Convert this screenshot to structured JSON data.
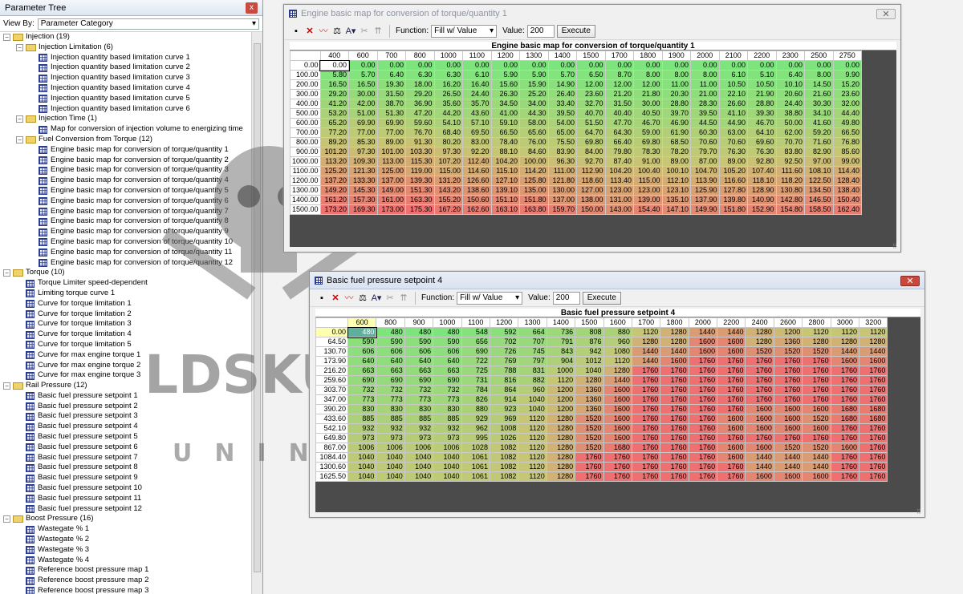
{
  "tree": {
    "title": "Parameter Tree",
    "close": "x",
    "view_by_label": "View By:",
    "view_by_value": "Parameter Category",
    "nodes": [
      {
        "t": "Injection (19)",
        "l": 0,
        "k": "f"
      },
      {
        "t": "Injection Limitation (6)",
        "l": 1,
        "k": "f"
      },
      {
        "t": "Injection quantity based limitation curve 1",
        "l": 2,
        "k": "m"
      },
      {
        "t": "Injection quantity based limitation curve 2",
        "l": 2,
        "k": "m"
      },
      {
        "t": "Injection quantity based limitation curve 3",
        "l": 2,
        "k": "m"
      },
      {
        "t": "Injection quantity based limitation curve 4",
        "l": 2,
        "k": "m"
      },
      {
        "t": "Injection quantity based limitation curve 5",
        "l": 2,
        "k": "m"
      },
      {
        "t": "Injection quantity based limitation curve 6",
        "l": 2,
        "k": "m"
      },
      {
        "t": "Injection Time (1)",
        "l": 1,
        "k": "f"
      },
      {
        "t": "Map for conversion of injection volume to energizing time",
        "l": 2,
        "k": "m"
      },
      {
        "t": "Fuel Conversion from Torque (12)",
        "l": 1,
        "k": "f"
      },
      {
        "t": "Engine basic map for conversion of torque/quantity 1",
        "l": 2,
        "k": "m"
      },
      {
        "t": "Engine basic map for conversion of torque/quantity 2",
        "l": 2,
        "k": "m"
      },
      {
        "t": "Engine basic map for conversion of torque/quantity 3",
        "l": 2,
        "k": "m"
      },
      {
        "t": "Engine basic map for conversion of torque/quantity 4",
        "l": 2,
        "k": "m"
      },
      {
        "t": "Engine basic map for conversion of torque/quantity 5",
        "l": 2,
        "k": "m"
      },
      {
        "t": "Engine basic map for conversion of torque/quantity 6",
        "l": 2,
        "k": "m"
      },
      {
        "t": "Engine basic map for conversion of torque/quantity 7",
        "l": 2,
        "k": "m"
      },
      {
        "t": "Engine basic map for conversion of torque/quantity 8",
        "l": 2,
        "k": "m"
      },
      {
        "t": "Engine basic map for conversion of torque/quantity 9",
        "l": 2,
        "k": "m"
      },
      {
        "t": "Engine basic map for conversion of torque/quantity 10",
        "l": 2,
        "k": "m"
      },
      {
        "t": "Engine basic map for conversion of torque/quantity 11",
        "l": 2,
        "k": "m"
      },
      {
        "t": "Engine basic map for conversion of torque/quantity 12",
        "l": 2,
        "k": "m"
      },
      {
        "t": "Torque (10)",
        "l": 0,
        "k": "f"
      },
      {
        "t": "Torque Limiter speed-dependent",
        "l": 1,
        "k": "m"
      },
      {
        "t": "Limiting torque curve 1",
        "l": 1,
        "k": "m"
      },
      {
        "t": "Curve for torque limitation 1",
        "l": 1,
        "k": "m"
      },
      {
        "t": "Curve for torque limitation 2",
        "l": 1,
        "k": "m"
      },
      {
        "t": "Curve for torque limitation 3",
        "l": 1,
        "k": "m"
      },
      {
        "t": "Curve for torque limitation 4",
        "l": 1,
        "k": "m"
      },
      {
        "t": "Curve for torque limitation 5",
        "l": 1,
        "k": "m"
      },
      {
        "t": "Curve for max engine torque 1",
        "l": 1,
        "k": "m"
      },
      {
        "t": "Curve for max engine torque 2",
        "l": 1,
        "k": "m"
      },
      {
        "t": "Curve for max engine torque 3",
        "l": 1,
        "k": "m"
      },
      {
        "t": "Rail Pressure (12)",
        "l": 0,
        "k": "f"
      },
      {
        "t": "Basic fuel pressure setpoint 1",
        "l": 1,
        "k": "m"
      },
      {
        "t": "Basic fuel pressure setpoint 2",
        "l": 1,
        "k": "m"
      },
      {
        "t": "Basic fuel pressure setpoint 3",
        "l": 1,
        "k": "m"
      },
      {
        "t": "Basic fuel pressure setpoint 4",
        "l": 1,
        "k": "m"
      },
      {
        "t": "Basic fuel pressure setpoint 5",
        "l": 1,
        "k": "m"
      },
      {
        "t": "Basic fuel pressure setpoint 6",
        "l": 1,
        "k": "m"
      },
      {
        "t": "Basic fuel pressure setpoint 7",
        "l": 1,
        "k": "m"
      },
      {
        "t": "Basic fuel pressure setpoint 8",
        "l": 1,
        "k": "m"
      },
      {
        "t": "Basic fuel pressure setpoint 9",
        "l": 1,
        "k": "m"
      },
      {
        "t": "Basic fuel pressure setpoint 10",
        "l": 1,
        "k": "m"
      },
      {
        "t": "Basic fuel pressure setpoint 11",
        "l": 1,
        "k": "m"
      },
      {
        "t": "Basic fuel pressure setpoint 12",
        "l": 1,
        "k": "m"
      },
      {
        "t": "Boost Pressure (16)",
        "l": 0,
        "k": "f"
      },
      {
        "t": "Wastegate % 1",
        "l": 1,
        "k": "m"
      },
      {
        "t": "Wastegate % 2",
        "l": 1,
        "k": "m"
      },
      {
        "t": "Wastegate % 3",
        "l": 1,
        "k": "m"
      },
      {
        "t": "Wastegate % 4",
        "l": 1,
        "k": "m"
      },
      {
        "t": "Reference boost pressure map 1",
        "l": 1,
        "k": "m"
      },
      {
        "t": "Reference boost pressure map 2",
        "l": 1,
        "k": "m"
      },
      {
        "t": "Reference boost pressure map 3",
        "l": 1,
        "k": "m"
      }
    ]
  },
  "watermark": {
    "text1": "LDSKULL",
    "text2": "UNING"
  },
  "win1": {
    "title": "Engine basic map for conversion of torque/quantity 1",
    "function_label": "Function:",
    "function_value": "Fill w/ Value",
    "value_label": "Value:",
    "value": "200",
    "execute": "Execute",
    "table_title": "Engine basic map for conversion of torque/quantity 1",
    "cols": [
      "400",
      "600",
      "700",
      "800",
      "1000",
      "1100",
      "1200",
      "1300",
      "1400",
      "1500",
      "1700",
      "1800",
      "1900",
      "2000",
      "2100",
      "2200",
      "2300",
      "2500",
      "2750"
    ],
    "rows": [
      "0.00",
      "100.00",
      "200.00",
      "300.00",
      "400.00",
      "500.00",
      "600.00",
      "700.00",
      "800.00",
      "900.00",
      "1000.00",
      "1100.00",
      "1200.00",
      "1300.00",
      "1400.00",
      "1500.00"
    ],
    "cells": [
      [
        "0.00",
        "0.00",
        "0.00",
        "0.00",
        "0.00",
        "0.00",
        "0.00",
        "0.00",
        "0.00",
        "0.00",
        "0.00",
        "0.00",
        "0.00",
        "0.00",
        "0.00",
        "0.00",
        "0.00",
        "0.00",
        "0.00"
      ],
      [
        "5.80",
        "5.70",
        "6.40",
        "6.30",
        "6.30",
        "6.10",
        "5.90",
        "5.90",
        "5.70",
        "6.50",
        "8.70",
        "8.00",
        "8.00",
        "8.00",
        "6.10",
        "5.10",
        "6.40",
        "8.00",
        "9.90"
      ],
      [
        "16.50",
        "16.50",
        "19.30",
        "18.00",
        "16.20",
        "16.40",
        "15.60",
        "15.90",
        "14.90",
        "12.00",
        "12.00",
        "12.00",
        "11.00",
        "11.00",
        "10.50",
        "10.50",
        "10.10",
        "14.50",
        "15.20"
      ],
      [
        "29.20",
        "30.00",
        "31.50",
        "29.20",
        "26.50",
        "24.40",
        "26.30",
        "25.20",
        "26.40",
        "23.60",
        "21.20",
        "21.80",
        "20.30",
        "21.00",
        "22.10",
        "21.90",
        "20.60",
        "21.60",
        "23.60"
      ],
      [
        "41.20",
        "42.00",
        "38.70",
        "36.90",
        "35.60",
        "35.70",
        "34.50",
        "34.00",
        "33.40",
        "32.70",
        "31.50",
        "30.00",
        "28.80",
        "28.30",
        "26.60",
        "28.80",
        "24.40",
        "30.30",
        "32.00"
      ],
      [
        "53.20",
        "51.00",
        "51.30",
        "47.20",
        "44.20",
        "43.60",
        "41.00",
        "44.30",
        "39.50",
        "40.70",
        "40.40",
        "40.50",
        "39.70",
        "39.50",
        "41.10",
        "39.30",
        "38.80",
        "34.10",
        "44.40"
      ],
      [
        "65.20",
        "69.90",
        "69.90",
        "59.60",
        "54.10",
        "57.10",
        "59.10",
        "58.00",
        "54.00",
        "51.50",
        "47.70",
        "46.70",
        "46.90",
        "44.50",
        "44.90",
        "46.70",
        "50.00",
        "41.60",
        "49.80"
      ],
      [
        "77.20",
        "77.00",
        "77.00",
        "76.70",
        "68.40",
        "69.50",
        "66.50",
        "65.60",
        "65.00",
        "64.70",
        "64.30",
        "59.00",
        "61.90",
        "60.30",
        "63.00",
        "64.10",
        "62.00",
        "59.20",
        "66.50"
      ],
      [
        "89.20",
        "85.30",
        "89.00",
        "91.30",
        "80.20",
        "83.00",
        "78.40",
        "76.00",
        "75.50",
        "69.80",
        "66.40",
        "69.80",
        "68.50",
        "70.60",
        "70.60",
        "69.60",
        "70.70",
        "71.60",
        "76.80"
      ],
      [
        "101.20",
        "97.30",
        "101.00",
        "103.30",
        "97.30",
        "92.20",
        "88.10",
        "84.60",
        "83.90",
        "84.00",
        "79.80",
        "78.30",
        "78.20",
        "79.70",
        "76.30",
        "76.30",
        "83.80",
        "82.90",
        "85.60"
      ],
      [
        "113.20",
        "109.30",
        "113.00",
        "115.30",
        "107.20",
        "112.40",
        "104.20",
        "100.00",
        "96.30",
        "92.70",
        "87.40",
        "91.00",
        "89.00",
        "87.00",
        "89.00",
        "92.80",
        "92.50",
        "97.00",
        "99.00"
      ],
      [
        "125.20",
        "121.30",
        "125.00",
        "119.00",
        "115.00",
        "114.60",
        "115.10",
        "114.20",
        "111.00",
        "112.90",
        "104.20",
        "100.40",
        "100.10",
        "104.70",
        "105.20",
        "107.40",
        "111.60",
        "108.10",
        "114.40"
      ],
      [
        "137.20",
        "133.30",
        "137.00",
        "139.30",
        "131.20",
        "126.60",
        "127.10",
        "125.80",
        "121.80",
        "118.60",
        "113.40",
        "115.00",
        "112.10",
        "113.90",
        "116.60",
        "118.10",
        "118.20",
        "122.50",
        "128.40"
      ],
      [
        "149.20",
        "145.30",
        "149.00",
        "151.30",
        "143.20",
        "138.60",
        "139.10",
        "135.00",
        "130.00",
        "127.00",
        "123.00",
        "123.00",
        "123.10",
        "125.90",
        "127.80",
        "128.90",
        "130.80",
        "134.50",
        "138.40"
      ],
      [
        "161.20",
        "157.30",
        "161.00",
        "163.30",
        "155.20",
        "150.60",
        "151.10",
        "151.80",
        "137.00",
        "138.00",
        "131.00",
        "139.00",
        "135.10",
        "137.90",
        "139.80",
        "140.90",
        "142.80",
        "146.50",
        "150.40"
      ],
      [
        "173.20",
        "169.30",
        "173.00",
        "175.30",
        "167.20",
        "162.60",
        "163.10",
        "163.80",
        "159.70",
        "150.00",
        "143.00",
        "154.40",
        "147.10",
        "149.90",
        "151.80",
        "152.90",
        "154.80",
        "158.50",
        "162.40"
      ]
    ]
  },
  "win2": {
    "title": "Basic fuel pressure setpoint 4",
    "function_label": "Function:",
    "function_value": "Fill w/ Value",
    "value_label": "Value:",
    "value": "200",
    "execute": "Execute",
    "table_title": "Basic fuel pressure setpoint 4",
    "cols": [
      "600",
      "800",
      "900",
      "1000",
      "1100",
      "1200",
      "1300",
      "1400",
      "1500",
      "1600",
      "1700",
      "1800",
      "2000",
      "2200",
      "2400",
      "2600",
      "2800",
      "3000",
      "3200"
    ],
    "rows": [
      "0.00",
      "64.50",
      "130.70",
      "173.90",
      "216.20",
      "259.60",
      "303.70",
      "347.00",
      "390.20",
      "433.60",
      "542.10",
      "649.80",
      "867.00",
      "1084.40",
      "1300.60",
      "1625.50"
    ],
    "cells": [
      [
        "480",
        "480",
        "480",
        "480",
        "548",
        "592",
        "664",
        "736",
        "808",
        "880",
        "1120",
        "1280",
        "1440",
        "1440",
        "1280",
        "1200",
        "1120",
        "1120",
        "1120"
      ],
      [
        "590",
        "590",
        "590",
        "590",
        "656",
        "702",
        "707",
        "791",
        "876",
        "960",
        "1280",
        "1280",
        "1600",
        "1600",
        "1280",
        "1360",
        "1280",
        "1280",
        "1280"
      ],
      [
        "606",
        "606",
        "606",
        "606",
        "690",
        "726",
        "745",
        "843",
        "942",
        "1080",
        "1440",
        "1440",
        "1600",
        "1600",
        "1520",
        "1520",
        "1520",
        "1440",
        "1440"
      ],
      [
        "640",
        "640",
        "640",
        "640",
        "722",
        "769",
        "797",
        "904",
        "1012",
        "1120",
        "1440",
        "1600",
        "1760",
        "1760",
        "1760",
        "1760",
        "1760",
        "1600",
        "1600"
      ],
      [
        "663",
        "663",
        "663",
        "663",
        "725",
        "788",
        "831",
        "1000",
        "1040",
        "1280",
        "1760",
        "1760",
        "1760",
        "1760",
        "1760",
        "1760",
        "1760",
        "1760",
        "1760"
      ],
      [
        "690",
        "690",
        "690",
        "690",
        "731",
        "816",
        "882",
        "1120",
        "1280",
        "1440",
        "1760",
        "1760",
        "1760",
        "1760",
        "1760",
        "1760",
        "1760",
        "1760",
        "1760"
      ],
      [
        "732",
        "732",
        "732",
        "732",
        "784",
        "864",
        "960",
        "1200",
        "1360",
        "1600",
        "1760",
        "1760",
        "1760",
        "1760",
        "1760",
        "1760",
        "1760",
        "1760",
        "1760"
      ],
      [
        "773",
        "773",
        "773",
        "773",
        "826",
        "914",
        "1040",
        "1200",
        "1360",
        "1600",
        "1760",
        "1760",
        "1760",
        "1760",
        "1760",
        "1760",
        "1760",
        "1760",
        "1760"
      ],
      [
        "830",
        "830",
        "830",
        "830",
        "880",
        "923",
        "1040",
        "1200",
        "1360",
        "1600",
        "1760",
        "1760",
        "1760",
        "1760",
        "1600",
        "1600",
        "1600",
        "1680",
        "1680"
      ],
      [
        "885",
        "885",
        "885",
        "885",
        "929",
        "969",
        "1120",
        "1280",
        "1520",
        "1600",
        "1760",
        "1760",
        "1760",
        "1600",
        "1600",
        "1600",
        "1520",
        "1680",
        "1680"
      ],
      [
        "932",
        "932",
        "932",
        "932",
        "962",
        "1008",
        "1120",
        "1280",
        "1520",
        "1600",
        "1760",
        "1760",
        "1760",
        "1600",
        "1600",
        "1600",
        "1600",
        "1760",
        "1760"
      ],
      [
        "973",
        "973",
        "973",
        "973",
        "995",
        "1026",
        "1120",
        "1280",
        "1520",
        "1600",
        "1760",
        "1760",
        "1760",
        "1760",
        "1760",
        "1760",
        "1760",
        "1760",
        "1760"
      ],
      [
        "1006",
        "1006",
        "1006",
        "1006",
        "1028",
        "1082",
        "1120",
        "1280",
        "1520",
        "1680",
        "1760",
        "1760",
        "1760",
        "1600",
        "1600",
        "1520",
        "1520",
        "1600",
        "1760"
      ],
      [
        "1040",
        "1040",
        "1040",
        "1040",
        "1061",
        "1082",
        "1120",
        "1280",
        "1760",
        "1760",
        "1760",
        "1760",
        "1760",
        "1600",
        "1440",
        "1440",
        "1440",
        "1760",
        "1760"
      ],
      [
        "1040",
        "1040",
        "1040",
        "1040",
        "1061",
        "1082",
        "1120",
        "1280",
        "1760",
        "1760",
        "1760",
        "1760",
        "1760",
        "1760",
        "1440",
        "1440",
        "1440",
        "1760",
        "1760"
      ],
      [
        "1040",
        "1040",
        "1040",
        "1040",
        "1061",
        "1082",
        "1120",
        "1280",
        "1760",
        "1760",
        "1760",
        "1760",
        "1760",
        "1760",
        "1600",
        "1600",
        "1600",
        "1760",
        "1760"
      ]
    ]
  },
  "colors": {
    "low": "#7ee57e",
    "mid": "#c7c675",
    "high": "#ee7070",
    "selected": "#ffffb0",
    "active": "#5faf9f"
  }
}
